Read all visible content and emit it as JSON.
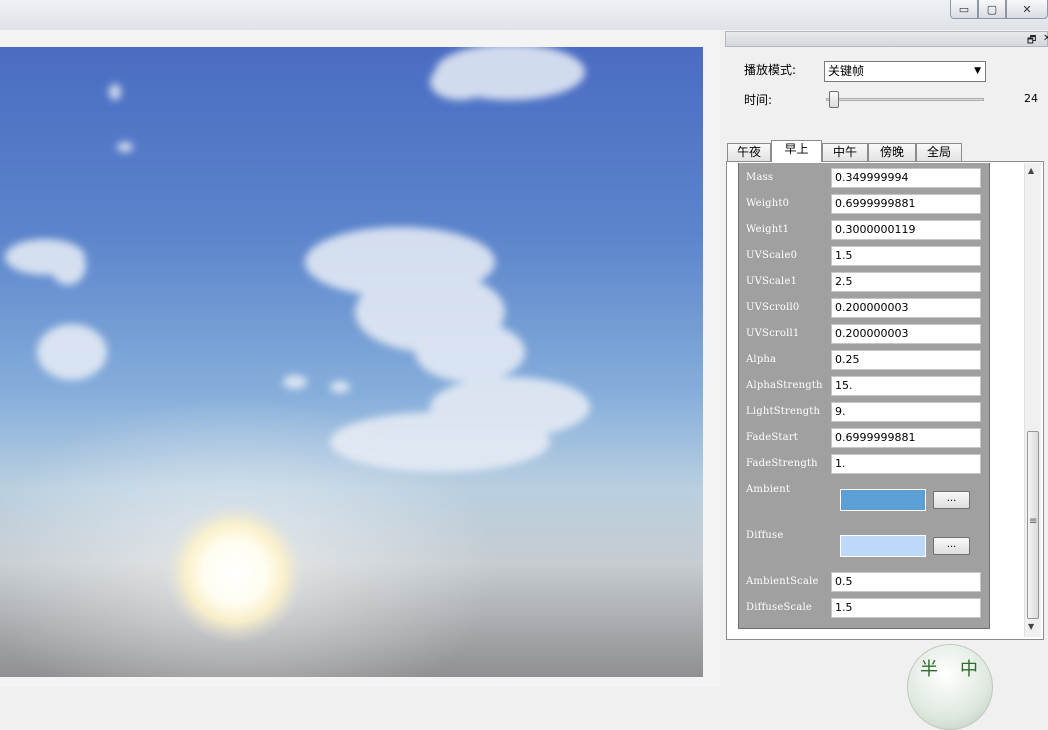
{
  "window": {
    "minimize": "▭",
    "maximize": "▢",
    "close": "✕"
  },
  "panel": {
    "restore_glyph": "🗗",
    "close_glyph": "✕"
  },
  "controls": {
    "play_mode_label": "播放模式:",
    "play_mode_value": "关键帧",
    "time_label": "时间:",
    "time_value": "24",
    "time_slider_fraction": 0.02
  },
  "tabs": [
    {
      "label": "午夜",
      "active": false
    },
    {
      "label": "早上",
      "active": true
    },
    {
      "label": "中午",
      "active": false
    },
    {
      "label": "傍晚",
      "active": false
    },
    {
      "label": "全局",
      "active": false
    }
  ],
  "properties": [
    {
      "name": "Mass",
      "value": "0.349999994"
    },
    {
      "name": "Weight0",
      "value": "0.6999999881"
    },
    {
      "name": "Weight1",
      "value": "0.3000000119"
    },
    {
      "name": "UVScale0",
      "value": "1.5"
    },
    {
      "name": "UVScale1",
      "value": "2.5"
    },
    {
      "name": "UVScroll0",
      "value": "0.200000003"
    },
    {
      "name": "UVScroll1",
      "value": "0.200000003"
    },
    {
      "name": "Alpha",
      "value": "0.25"
    },
    {
      "name": "AlphaStrength",
      "value": "15."
    },
    {
      "name": "LightStrength",
      "value": "9."
    },
    {
      "name": "FadeStart",
      "value": "0.6999999881"
    },
    {
      "name": "FadeStrength",
      "value": "1."
    }
  ],
  "colors": [
    {
      "name": "Ambient",
      "color": "#5b9fd6",
      "button": "..."
    },
    {
      "name": "Diffuse",
      "color": "#bcd9f7",
      "button": "..."
    }
  ],
  "scales": [
    {
      "name": "AmbientScale",
      "value": "0.5"
    },
    {
      "name": "DiffuseScale",
      "value": "1.5"
    }
  ],
  "scrollbar": {
    "up": "▲",
    "down": "▼",
    "grip": "≡"
  },
  "logo": {
    "char1": "半",
    "char2": "中"
  }
}
